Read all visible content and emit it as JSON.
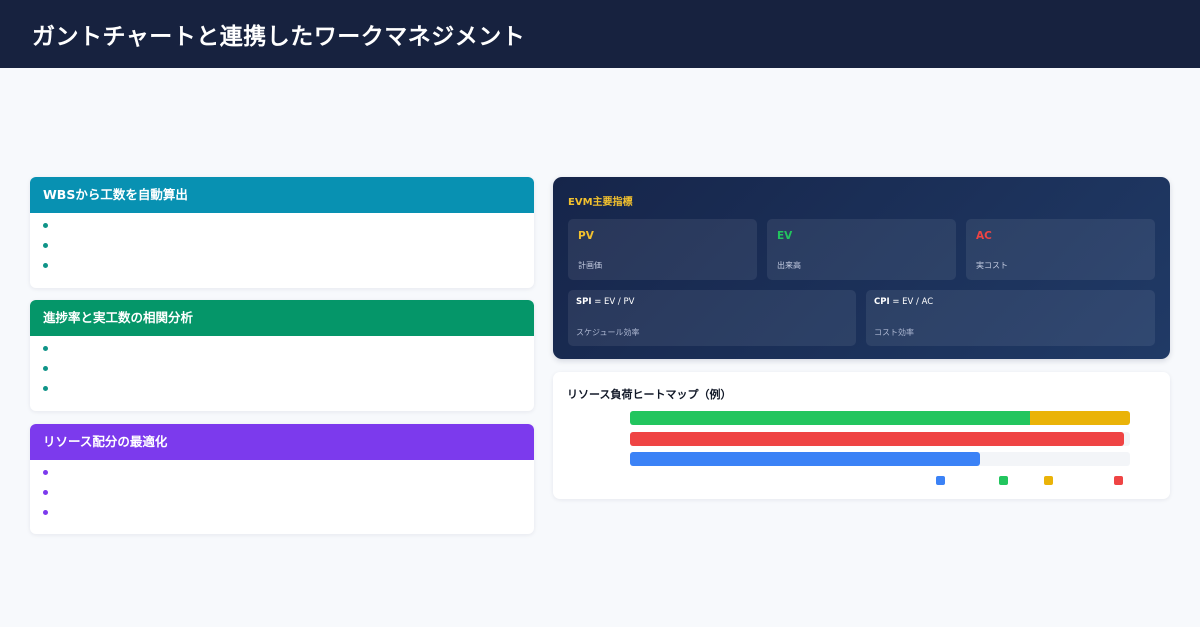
{
  "header": {
    "title": "ガントチャートと連携したワークマネジメント"
  },
  "features": [
    {
      "title": "WBSから工数を自動算出",
      "color": "#0891b2",
      "bullet_color": "#0f9488",
      "bullets": 3
    },
    {
      "title": "進捗率と実工数の相関分析",
      "color": "#059669",
      "bullet_color": "#0f9488",
      "bullets": 3
    },
    {
      "title": "リソース配分の最適化",
      "color": "#7c3aed",
      "bullet_color": "#7c3aed",
      "bullets": 3
    }
  ],
  "evm": {
    "title": "EVM主要指標",
    "metrics": [
      {
        "name": "PV",
        "desc": "計画価",
        "color": "#f2c12e"
      },
      {
        "name": "EV",
        "desc": "出来高",
        "color": "#22c55e"
      },
      {
        "name": "AC",
        "desc": "実コスト",
        "color": "#ef4444"
      }
    ],
    "formulas": [
      {
        "name": "SPI",
        "expr": " = EV / PV",
        "desc": "スケジュール効率"
      },
      {
        "name": "CPI",
        "expr": " = EV / AC",
        "desc": "コスト効率"
      }
    ]
  },
  "heatmap": {
    "title": "リソース負荷ヒートマップ（例）",
    "rows": [
      {
        "segments": [
          {
            "fraction": 0.8,
            "color": "#22c55e"
          },
          {
            "fraction": 0.2,
            "color": "#eab308"
          }
        ]
      },
      {
        "segments": [
          {
            "fraction": 0.988,
            "color": "#ef4444"
          }
        ]
      },
      {
        "segments": [
          {
            "fraction": 0.7,
            "color": "#3b82f6"
          }
        ]
      }
    ],
    "legend_colors": [
      "#3b82f6",
      "#22c55e",
      "#eab308",
      "#ef4444"
    ]
  }
}
